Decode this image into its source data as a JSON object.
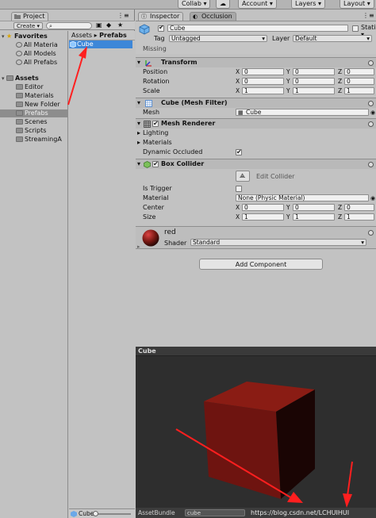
{
  "toolbar": {
    "collab_label": "Collab ▾",
    "account_label": "Account ▾",
    "layers_label": "Layers ▾",
    "layout_label": "Layout ▾"
  },
  "project_panel": {
    "tab_label": "Project",
    "create_label": "Create ▾",
    "favorites": {
      "label": "Favorites",
      "items": [
        "All Materia",
        "All Models",
        "All Prefabs"
      ]
    },
    "assets": {
      "label": "Assets",
      "items": [
        "Editor",
        "Materials",
        "New Folder",
        "Prefabs",
        "Scenes",
        "Scripts",
        "StreamingA"
      ],
      "selected": "Prefabs"
    },
    "breadcrumb": {
      "root": "Assets",
      "separator": "▸",
      "current": "Prefabs"
    },
    "files": [
      {
        "name": "Cube",
        "selected": true
      }
    ],
    "bottom_label": "Cube"
  },
  "inspector": {
    "tab_label": "Inspector",
    "occlusion_tab_label": "Occlusion",
    "object_name": "Cube",
    "static_label": "Static ▾",
    "tag_label": "Tag",
    "tag_value": "Untagged",
    "layer_label": "Layer",
    "layer_value": "Default",
    "prefab_status": "Missing",
    "transform": {
      "title": "Transform",
      "position": {
        "label": "Position",
        "x": "0",
        "y": "0",
        "z": "0"
      },
      "rotation": {
        "label": "Rotation",
        "x": "0",
        "y": "0",
        "z": "0"
      },
      "scale": {
        "label": "Scale",
        "x": "1",
        "y": "1",
        "z": "1"
      }
    },
    "mesh_filter": {
      "title": "Cube (Mesh Filter)",
      "mesh_label": "Mesh",
      "mesh_value": "Cube"
    },
    "mesh_renderer": {
      "title": "Mesh Renderer",
      "lighting_label": "Lighting",
      "materials_label": "Materials",
      "dynamic_occluded_label": "Dynamic Occluded",
      "dynamic_occluded": true
    },
    "box_collider": {
      "title": "Box Collider",
      "edit_collider_label": "Edit Collider",
      "is_trigger_label": "Is Trigger",
      "is_trigger": false,
      "material_label": "Material",
      "material_value": "None (Physic Material)",
      "center": {
        "label": "Center",
        "x": "0",
        "y": "0",
        "z": "0"
      },
      "size": {
        "label": "Size",
        "x": "1",
        "y": "1",
        "z": "1"
      }
    },
    "material": {
      "name": "red",
      "shader_label": "Shader",
      "shader_value": "Standard"
    },
    "add_component_label": "Add Component",
    "axis_x": "X",
    "axis_y": "Y",
    "axis_z": "Z"
  },
  "preview": {
    "title": "Cube",
    "asset_bundle_label": "AssetBundle",
    "asset_bundle_value": "cube",
    "watermark": "https://blog.csdn.net/LCHUIHUI"
  },
  "colors": {
    "selection_blue": "#3d87d8",
    "cube_red": "#6a1410",
    "arrow_red": "#ff1f1f"
  }
}
